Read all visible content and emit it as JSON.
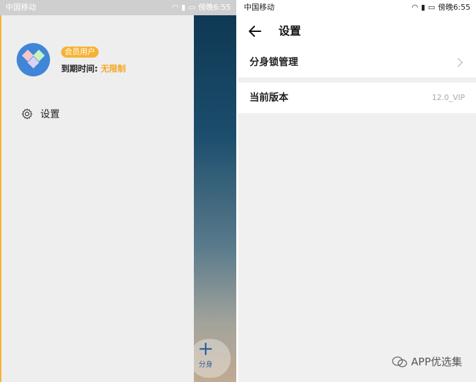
{
  "left": {
    "status": {
      "carrier": "中国移动",
      "time": "傍晚6:55"
    },
    "user": {
      "badge": "会员用户",
      "expire_label": "到期时间:",
      "expire_value": "无限制"
    },
    "menu": {
      "settings": "设置"
    },
    "fab": {
      "label": "分身"
    }
  },
  "right": {
    "status": {
      "carrier": "中国移动",
      "time": "傍晚6:55"
    },
    "title": "设置",
    "rows": [
      {
        "label": "分身锁管理"
      },
      {
        "label": "当前版本",
        "value": "12.0_VIP"
      }
    ]
  },
  "watermark": "APP优选集",
  "colors": {
    "accent": "#f5b335",
    "avatar": "#3f86d8"
  }
}
